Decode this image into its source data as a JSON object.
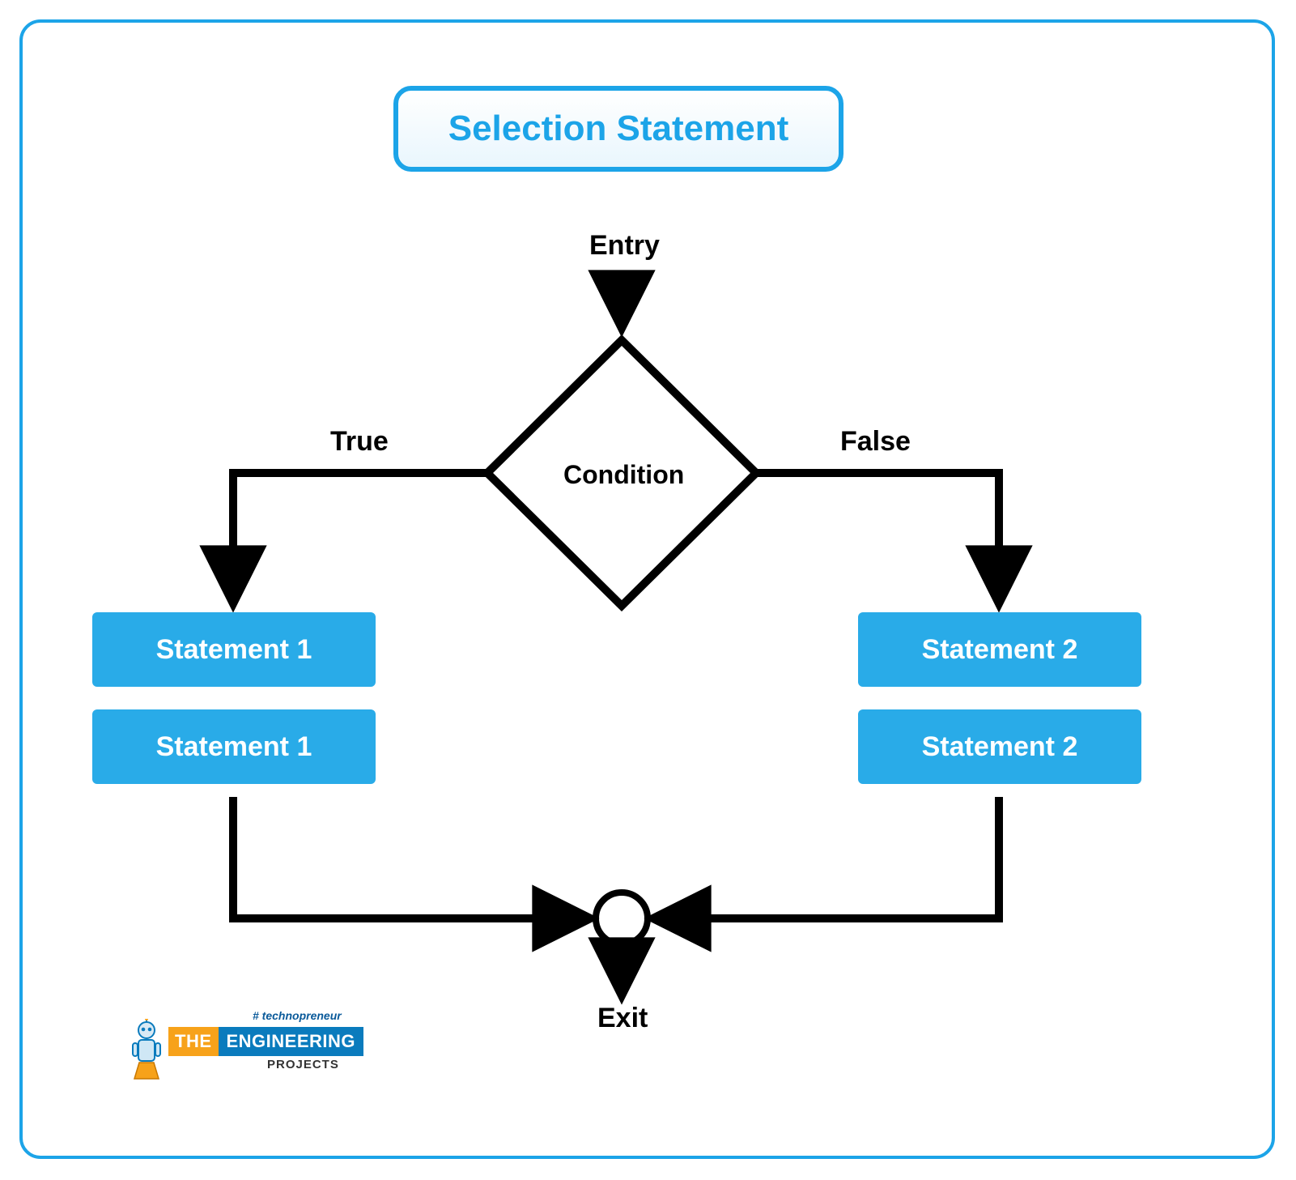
{
  "title": "Selection Statement",
  "entry_label": "Entry",
  "condition_label": "Condition",
  "true_label": "True",
  "false_label": "False",
  "exit_label": "Exit",
  "true_branch": {
    "stmt_a": "Statement 1",
    "stmt_b": "Statement 1"
  },
  "false_branch": {
    "stmt_a": "Statement 2",
    "stmt_b": "Statement 2"
  },
  "logo": {
    "hash": "# technopreneur",
    "the": "THE",
    "eng": "ENGINEERING",
    "projects": "PROJECTS"
  },
  "colors": {
    "border": "#1ca4e8",
    "block": "#29abe8",
    "arrow": "#000000"
  }
}
